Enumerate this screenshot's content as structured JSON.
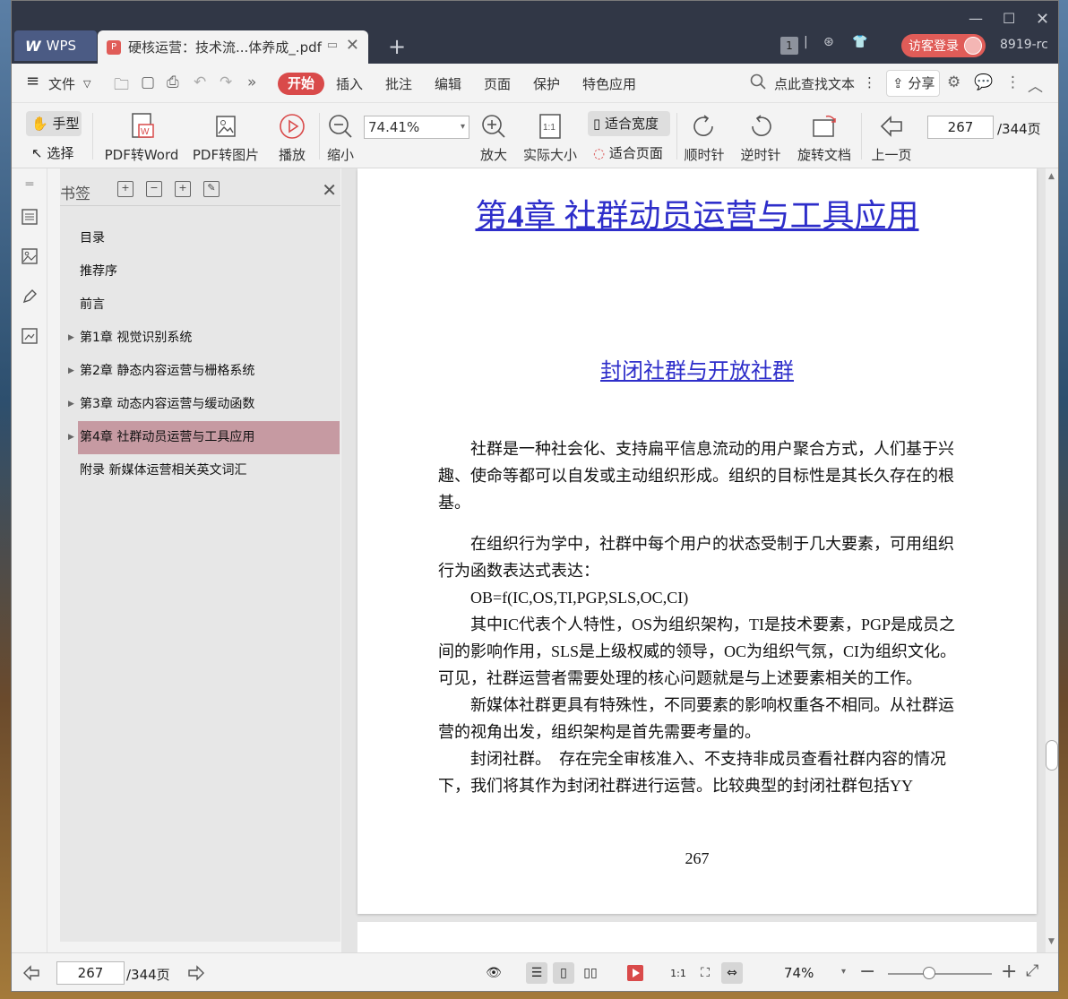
{
  "titlebar": {
    "wps_tab": "WPS",
    "doc_tab": "硬核运营：技术流...体养成_.pdf",
    "badge": "1",
    "login_button": "访客登录",
    "user_id": "8919-rc"
  },
  "menubar": {
    "file": "文件",
    "start": "开始",
    "items": [
      "插入",
      "批注",
      "编辑",
      "页面",
      "保护",
      "特色应用"
    ],
    "search_text": "点此查找文本",
    "share": "分享"
  },
  "toolbar": {
    "hand": "手型",
    "select": "选择",
    "pdf_to_word": "PDF转Word",
    "pdf_to_image": "PDF转图片",
    "play": "播放",
    "zoom_out": "缩小",
    "zoom_value": "74.41%",
    "zoom_in": "放大",
    "actual_size": "实际大小",
    "fit_width": "适合宽度",
    "fit_page": "适合页面",
    "clockwise": "顺时针",
    "counterclockwise": "逆时针",
    "rotate_doc": "旋转文档",
    "prev_page": "上一页",
    "page_value": "267",
    "page_total": "/344页"
  },
  "bookmarks": {
    "title": "书签",
    "items": [
      {
        "label": "目录",
        "expandable": false
      },
      {
        "label": "推荐序",
        "expandable": false
      },
      {
        "label": "前言",
        "expandable": false
      },
      {
        "label": "第1章 视觉识别系统",
        "expandable": true
      },
      {
        "label": "第2章 静态内容运营与栅格系统",
        "expandable": true
      },
      {
        "label": "第3章 动态内容运营与缓动函数",
        "expandable": true
      },
      {
        "label": "第4章 社群动员运营与工具应用",
        "expandable": true,
        "active": true
      },
      {
        "label": "附录 新媒体运营相关英文词汇",
        "expandable": false
      }
    ]
  },
  "document": {
    "chapter_title_prefix": "第",
    "chapter_number": "4",
    "chapter_title_rest": "章 社群动员运营与工具应用",
    "section_title": "封闭社群与开放社群",
    "paragraphs": [
      "社群是一种社会化、支持扁平信息流动的用户聚合方式，人们基于兴趣、使命等都可以自发或主动组织形成。组织的目标性是其长久存在的根基。",
      "在组织行为学中，社群中每个用户的状态受制于几大要素，可用组织行为函数表达式表达：",
      "OB=f(IC,OS,TI,PGP,SLS,OC,CI)",
      "其中IC代表个人特性，OS为组织架构，TI是技术要素，PGP是成员之间的影响作用，SLS是上级权威的领导，OC为组织气氛，CI为组织文化。可见，社群运营者需要处理的核心问题就是与上述要素相关的工作。",
      "新媒体社群更具有特殊性，不同要素的影响权重各不相同。从社群运营的视角出发，组织架构是首先需要考量的。",
      "封闭社群。　存在完全审核准入、不支持非成员查看社群内容的情况下，我们将其作为封闭社群进行运营。比较典型的封闭社群包括YY"
    ],
    "page_number": "267"
  },
  "statusbar": {
    "page_value": "267",
    "page_total": "/344页",
    "zoom": "74%",
    "zoom_level": 0.4
  }
}
